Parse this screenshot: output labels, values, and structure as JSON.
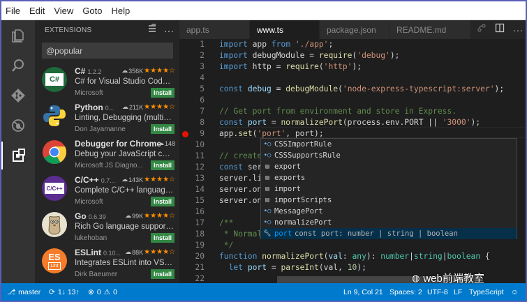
{
  "menu": [
    "File",
    "Edit",
    "View",
    "Goto",
    "Help"
  ],
  "activity": [
    "explorer-icon",
    "search-icon",
    "git-icon",
    "debug-icon",
    "extensions-icon"
  ],
  "sidebar": {
    "title": "EXTENSIONS",
    "search_value": "@popular",
    "extensions": [
      {
        "name": "C#",
        "version": "1.2.2",
        "installs": "356K",
        "stars": "★★★★☆",
        "description": "C# for Visual Studio Code (p...",
        "publisher": "Microsoft",
        "install_label": "Install",
        "logo_text": "C#",
        "logo_color": "#1e6a3a",
        "icon": "csharp-logo"
      },
      {
        "name": "Python",
        "version": "0...",
        "installs": "211K",
        "stars": "★★★★☆",
        "description": "Linting, Debugging (multi-t...",
        "publisher": "Don Jayamanne",
        "install_label": "Install",
        "logo_text": "",
        "logo_color": "#3572a5",
        "icon": "python-logo"
      },
      {
        "name": "Debugger for Chrome",
        "version": "",
        "installs": "148",
        "stars": "",
        "description": "Debug your JavaScript code...",
        "publisher": "Microsoft JS Diagno...",
        "install_label": "Install",
        "logo_text": "",
        "logo_color": "#db4437",
        "icon": "chrome-logo"
      },
      {
        "name": "C/C++",
        "version": "0.7...",
        "installs": "143K",
        "stars": "★★★★☆",
        "description": "Complete C/C++ language ...",
        "publisher": "Microsoft",
        "install_label": "Install",
        "logo_text": "C/C++",
        "logo_color": "#5c2d91",
        "icon": "cpp-logo"
      },
      {
        "name": "Go",
        "version": "0.6.39",
        "installs": "99K",
        "stars": "★★★★☆",
        "description": "Rich Go language support f...",
        "publisher": "lukehoban",
        "install_label": "Install",
        "logo_text": "",
        "logo_color": "#e8e2d0",
        "icon": "gopher-logo"
      },
      {
        "name": "ESLint",
        "version": "0.10...",
        "installs": "88K",
        "stars": "★★★★☆",
        "description": "Integrates ESLint into VS Co...",
        "publisher": "Dirk Baeumer",
        "install_label": "Install",
        "logo_text": "ES",
        "logo_sub": "Lint",
        "logo_color": "#f47c2a",
        "icon": "eslint-logo"
      }
    ]
  },
  "tabs": [
    {
      "label": "app.ts",
      "active": false
    },
    {
      "label": "www.ts",
      "active": true
    },
    {
      "label": "package.json",
      "active": false
    },
    {
      "label": "README.md",
      "active": false
    }
  ],
  "editor": {
    "line_numbers": [
      "1",
      "2",
      "3",
      "4",
      "5",
      "6",
      "7",
      "8",
      "9",
      "10",
      "11",
      "12",
      "13",
      "14",
      "15",
      "16",
      "17",
      "18",
      "19",
      "20",
      "21",
      "22"
    ],
    "breakpoint_line": "8"
  },
  "suggest": [
    {
      "icon": "ref",
      "label": "CSSImportRule",
      "selected": false
    },
    {
      "icon": "ref",
      "label": "CSSSupportsRule",
      "selected": false
    },
    {
      "icon": "module",
      "label": "export",
      "selected": false
    },
    {
      "icon": "module",
      "label": "exports",
      "selected": false
    },
    {
      "icon": "module",
      "label": "import",
      "selected": false
    },
    {
      "icon": "module",
      "label": "importScripts",
      "selected": false
    },
    {
      "icon": "ref",
      "label": "MessagePort",
      "selected": false
    },
    {
      "icon": "ref",
      "label": "normalizePort",
      "selected": false
    },
    {
      "icon": "wrench",
      "label": "port",
      "detail": "const port: number | string | boolean",
      "selected": true
    }
  ],
  "status": {
    "branch": "master",
    "sync": "1↓ 13↑",
    "problems": "0",
    "warnings": "0",
    "position": "Ln 9, Col 21",
    "spaces": "Spaces: 2",
    "encoding": "UTF-8",
    "eol": "LF",
    "language": "TypeScript"
  },
  "watermark": "web前端教室",
  "colors": {
    "accent": "#007acc",
    "install": "#338844",
    "breakpoint": "#e51400",
    "frame": "#5a5fb8"
  }
}
